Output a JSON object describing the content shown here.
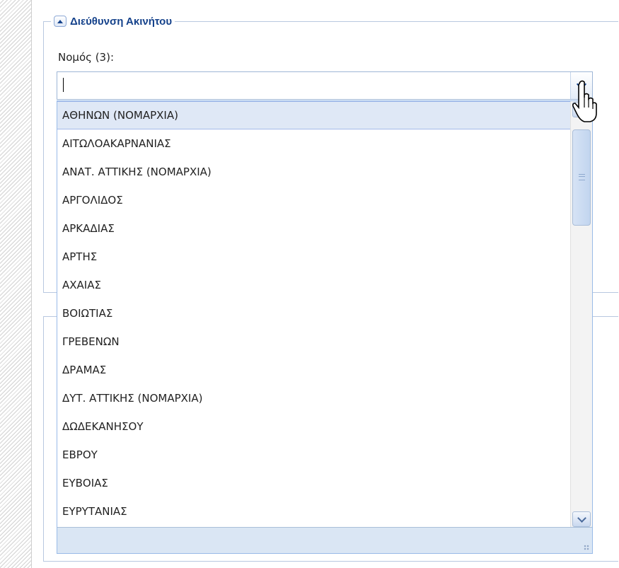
{
  "fieldset": {
    "title": "Διεύθυνση Ακινήτου",
    "collapse_icon": "collapse-up-icon"
  },
  "field": {
    "label": "Νομός (3):",
    "value": "",
    "trigger_icon": "chevron-down-icon"
  },
  "dropdown": {
    "selected_index": 0,
    "items": [
      "ΑΘΗΝΩΝ (ΝΟΜΑΡΧΙΑ)",
      "ΑΙΤΩΛΟΑΚΑΡΝΑΝΙΑΣ",
      "ΑΝΑΤ. ΑΤΤΙΚΗΣ (ΝΟΜΑΡΧΙΑ)",
      "ΑΡΓΟΛΙΔΟΣ",
      "ΑΡΚΑΔΙΑΣ",
      "ΑΡΤΗΣ",
      "ΑΧΑΙΑΣ",
      "ΒΟΙΩΤΙΑΣ",
      "ΓΡΕΒΕΝΩΝ",
      "ΔΡΑΜΑΣ",
      "ΔΥΤ. ΑΤΤΙΚΗΣ (ΝΟΜΑΡΧΙΑ)",
      "ΔΩΔΕΚΑΝΗΣΟΥ",
      "ΕΒΡΟΥ",
      "ΕΥΒΟΙΑΣ",
      "ΕΥΡΥΤΑΝΙΑΣ"
    ]
  },
  "colors": {
    "accent": "#15428b",
    "selected_bg": "#dfe8f6",
    "border": "#99bbe8"
  }
}
